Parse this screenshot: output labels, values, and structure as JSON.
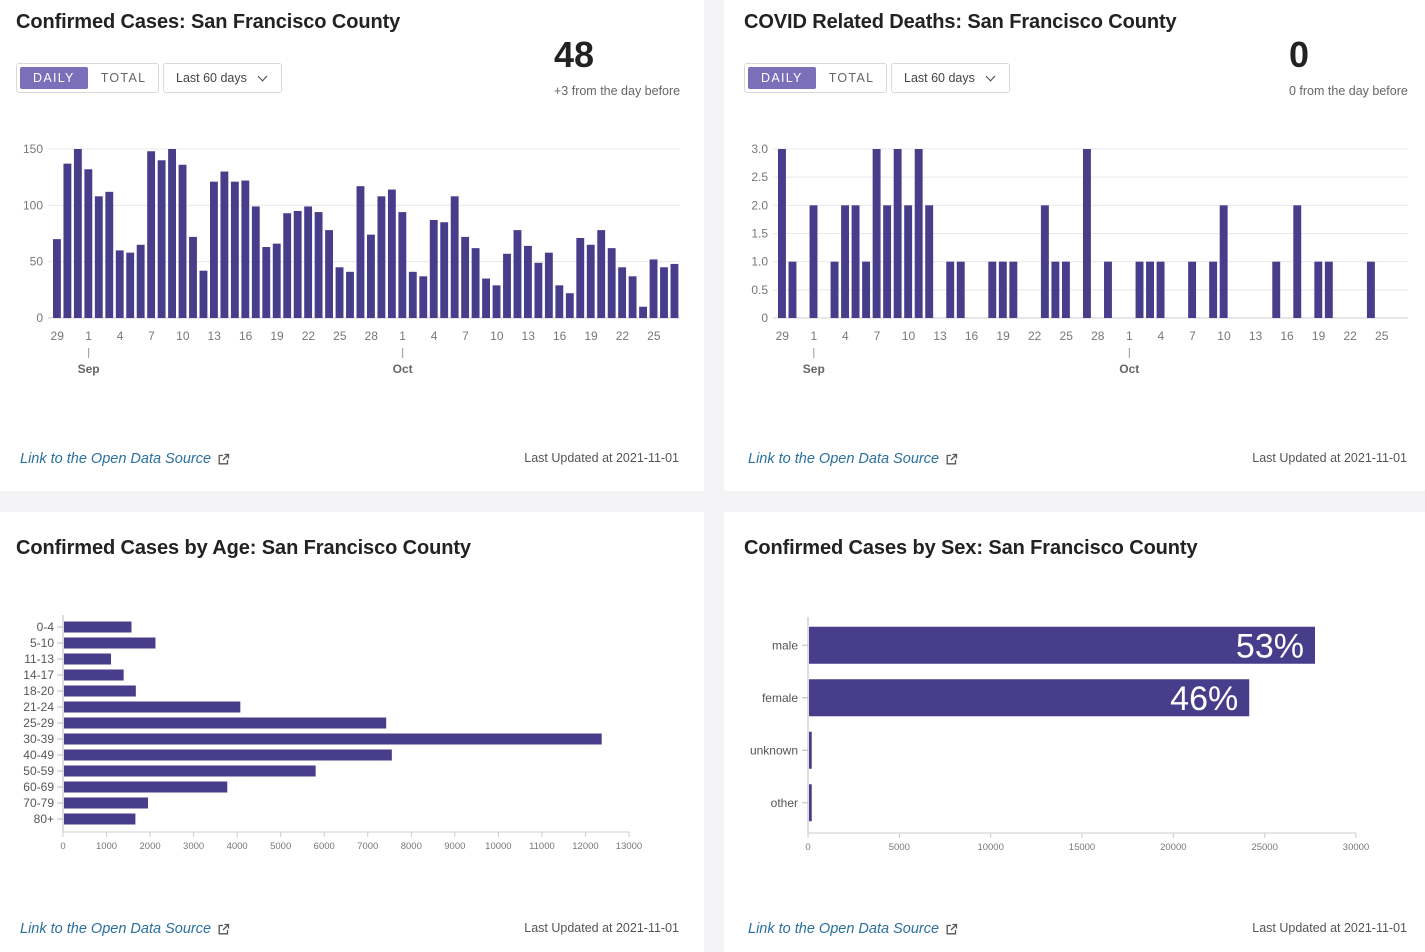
{
  "cases": {
    "title": "Confirmed Cases: San Francisco County",
    "toggle": {
      "daily": "DAILY",
      "total": "TOTAL"
    },
    "range": "Last 60 days",
    "big_number": "48",
    "delta_text": "+3 from the day before",
    "link_text": "Link to the Open Data Source",
    "updated": "Last Updated at 2021-11-01"
  },
  "deaths": {
    "title": "COVID Related Deaths: San Francisco County",
    "toggle": {
      "daily": "DAILY",
      "total": "TOTAL"
    },
    "range": "Last 60 days",
    "big_number": "0",
    "delta_text": "0 from the day before",
    "link_text": "Link to the Open Data Source",
    "updated": "Last Updated at 2021-11-01"
  },
  "age": {
    "title": "Confirmed Cases by Age: San Francisco County",
    "link_text": "Link to the Open Data Source",
    "updated": "Last Updated at 2021-11-01"
  },
  "sex": {
    "title": "Confirmed Cases by Sex: San Francisco County",
    "link_text": "Link to the Open Data Source",
    "updated": "Last Updated at 2021-11-01"
  },
  "colors": {
    "bar": "#473d8b",
    "accent": "#7a6fb8",
    "link": "#2a6f9e",
    "grid": "#e8e8ec",
    "axis": "#999999"
  },
  "chart_data": [
    {
      "id": "cases",
      "type": "bar",
      "title": "Confirmed Cases: San Francisco County",
      "x_tick_labels": [
        "29",
        "1",
        "4",
        "7",
        "10",
        "13",
        "16",
        "19",
        "22",
        "25",
        "28",
        "1",
        "4",
        "7",
        "10",
        "13",
        "16",
        "19",
        "22",
        "25"
      ],
      "month_labels": [
        "Sep",
        "Oct"
      ],
      "y_ticks": [
        0,
        50,
        100,
        150
      ],
      "ylim": [
        0,
        150
      ],
      "values": [
        70,
        137,
        150,
        132,
        108,
        112,
        60,
        58,
        65,
        148,
        140,
        150,
        136,
        72,
        42,
        121,
        130,
        121,
        122,
        99,
        63,
        66,
        93,
        95,
        99,
        94,
        78,
        45,
        41,
        117,
        74,
        108,
        114,
        94,
        41,
        37,
        87,
        85,
        108,
        72,
        62,
        35,
        29,
        57,
        78,
        64,
        49,
        58,
        29,
        22,
        71,
        65,
        78,
        62,
        45,
        37,
        10,
        52,
        45,
        48
      ],
      "ylabel": "",
      "xlabel": "",
      "grid": true,
      "legend": "none"
    },
    {
      "id": "deaths",
      "type": "bar",
      "title": "COVID Related Deaths: San Francisco County",
      "x_tick_labels": [
        "29",
        "1",
        "4",
        "7",
        "10",
        "13",
        "16",
        "19",
        "22",
        "25",
        "28",
        "1",
        "4",
        "7",
        "10",
        "13",
        "16",
        "19",
        "22",
        "25"
      ],
      "month_labels": [
        "Sep",
        "Oct"
      ],
      "y_ticks": [
        "0",
        "0.5",
        "1.0",
        "1.5",
        "2.0",
        "2.5",
        "3.0"
      ],
      "ylim": [
        0,
        3
      ],
      "values": [
        3,
        1,
        0,
        2,
        0,
        1,
        2,
        2,
        1,
        3,
        2,
        3,
        2,
        3,
        2,
        0,
        1,
        1,
        0,
        0,
        1,
        1,
        1,
        0,
        0,
        2,
        1,
        1,
        0,
        3,
        0,
        1,
        0,
        0,
        1,
        1,
        1,
        0,
        0,
        1,
        0,
        1,
        2,
        0,
        0,
        0,
        0,
        1,
        0,
        2,
        0,
        1,
        1,
        0,
        0,
        0,
        1,
        0,
        0,
        0
      ],
      "ylabel": "",
      "xlabel": "",
      "grid": true,
      "legend": "none"
    },
    {
      "id": "age",
      "type": "bar",
      "orientation": "horizontal",
      "title": "Confirmed Cases by Age: San Francisco County",
      "categories": [
        "0-4",
        "5-10",
        "11-13",
        "14-17",
        "18-20",
        "21-24",
        "25-29",
        "30-39",
        "40-49",
        "50-59",
        "60-69",
        "70-79",
        "80+"
      ],
      "values": [
        1550,
        2100,
        1080,
        1370,
        1650,
        4050,
        7400,
        12350,
        7530,
        5780,
        3750,
        1930,
        1640
      ],
      "x_ticks": [
        0,
        1000,
        2000,
        3000,
        4000,
        5000,
        6000,
        7000,
        8000,
        9000,
        10000,
        11000,
        12000,
        13000
      ],
      "xlim": [
        0,
        13000
      ],
      "grid": false,
      "legend": "none"
    },
    {
      "id": "sex",
      "type": "bar",
      "orientation": "horizontal",
      "title": "Confirmed Cases by Sex: San Francisco County",
      "categories": [
        "male",
        "female",
        "unknown",
        "other"
      ],
      "values": [
        27700,
        24100,
        150,
        150
      ],
      "data_labels": [
        "53%",
        "46%",
        "",
        ""
      ],
      "x_ticks": [
        0,
        5000,
        10000,
        15000,
        20000,
        25000,
        30000
      ],
      "xlim": [
        0,
        30000
      ],
      "grid": false,
      "legend": "none"
    }
  ]
}
